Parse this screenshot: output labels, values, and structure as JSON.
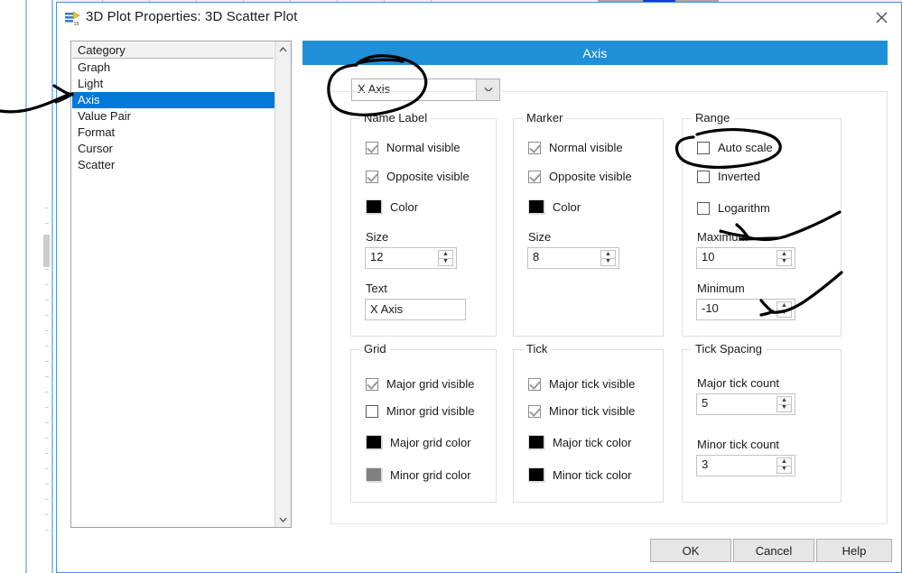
{
  "window": {
    "title": "3D Plot Properties: 3D Scatter Plot",
    "icon": "app-icon",
    "close_icon": "close-icon"
  },
  "category_list": {
    "header": "Category",
    "items": [
      {
        "label": "Graph",
        "selected": false
      },
      {
        "label": "Light",
        "selected": false
      },
      {
        "label": "Axis",
        "selected": true
      },
      {
        "label": "Value Pair",
        "selected": false
      },
      {
        "label": "Format",
        "selected": false
      },
      {
        "label": "Cursor",
        "selected": false
      },
      {
        "label": "Scatter",
        "selected": false
      }
    ],
    "scroll_up_icon": "chevron-up-icon",
    "scroll_down_icon": "chevron-down-icon"
  },
  "panel": {
    "banner": "Axis",
    "axis_selector": {
      "value": "X Axis",
      "chevron_icon": "chevron-down-icon"
    },
    "name_label": {
      "title": "Name Label",
      "normal_visible": {
        "label": "Normal visible",
        "checked": true,
        "disabled": true
      },
      "opposite_visible": {
        "label": "Opposite visible",
        "checked": true,
        "disabled": true
      },
      "color": {
        "label": "Color",
        "value": "#000000"
      },
      "size": {
        "label": "Size",
        "value": "12"
      },
      "text": {
        "label": "Text",
        "value": "X Axis"
      }
    },
    "marker": {
      "title": "Marker",
      "normal_visible": {
        "label": "Normal visible",
        "checked": true,
        "disabled": true
      },
      "opposite_visible": {
        "label": "Opposite visible",
        "checked": true,
        "disabled": true
      },
      "color": {
        "label": "Color",
        "value": "#000000"
      },
      "size": {
        "label": "Size",
        "value": "8"
      }
    },
    "range": {
      "title": "Range",
      "auto_scale": {
        "label": "Auto scale",
        "checked": false
      },
      "inverted": {
        "label": "Inverted",
        "checked": false
      },
      "logarithm": {
        "label": "Logarithm",
        "checked": false
      },
      "maximum": {
        "label": "Maximum",
        "value": "10"
      },
      "minimum": {
        "label": "Minimum",
        "value": "-10"
      }
    },
    "grid": {
      "title": "Grid",
      "major_visible": {
        "label": "Major grid visible",
        "checked": true,
        "disabled": true
      },
      "minor_visible": {
        "label": "Minor grid visible",
        "checked": false
      },
      "major_color": {
        "label": "Major grid color",
        "value": "#000000"
      },
      "minor_color": {
        "label": "Minor grid color",
        "value": "#808080"
      }
    },
    "tick": {
      "title": "Tick",
      "major_visible": {
        "label": "Major tick visible",
        "checked": true,
        "disabled": true
      },
      "minor_visible": {
        "label": "Minor tick visible",
        "checked": true,
        "disabled": true
      },
      "major_color": {
        "label": "Major tick color",
        "value": "#000000"
      },
      "minor_color": {
        "label": "Minor tick color",
        "value": "#000000"
      }
    },
    "tick_spacing": {
      "title": "Tick Spacing",
      "major_count": {
        "label": "Major tick count",
        "value": "5"
      },
      "minor_count": {
        "label": "Minor tick count",
        "value": "3"
      }
    }
  },
  "footer": {
    "ok": "OK",
    "cancel": "Cancel",
    "help": "Help"
  },
  "annotations": {
    "arrow_to_axis_item": "hand-drawn-arrow",
    "circle_axis_selector": "hand-drawn-circle",
    "circle_auto_scale": "hand-drawn-circle",
    "arrow_to_maximum": "hand-drawn-arrow",
    "arrow_to_minimum": "hand-drawn-arrow"
  },
  "colors": {
    "accent": "#0078d7",
    "banner": "#1f8fd8",
    "window_border": "#4a90d9"
  }
}
